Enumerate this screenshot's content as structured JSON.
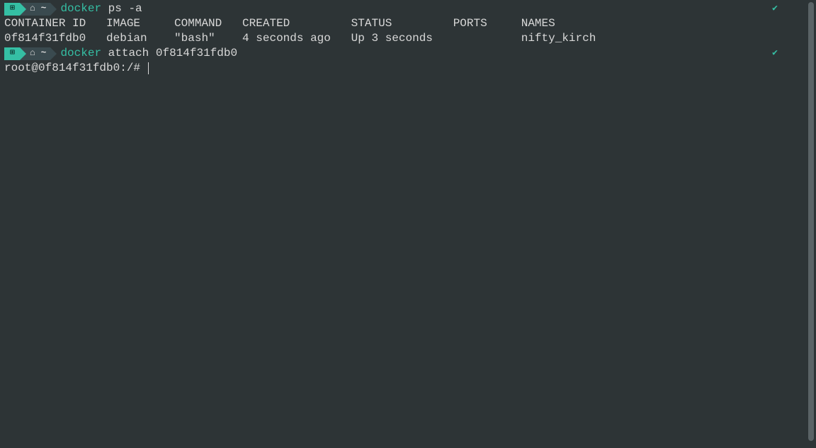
{
  "prompt1": {
    "path_icon": "⌂",
    "path_tilde": "~",
    "cmd_name": "docker",
    "cmd_args": " ps -a",
    "status": "✔"
  },
  "ps_header": "CONTAINER ID   IMAGE     COMMAND   CREATED         STATUS         PORTS     NAMES",
  "ps_row": "0f814f31fdb0   debian    \"bash\"    4 seconds ago   Up 3 seconds             nifty_kirch",
  "prompt2": {
    "path_icon": "⌂",
    "path_tilde": "~",
    "cmd_name": "docker",
    "cmd_args": " attach 0f814f31fdb0",
    "status": "✔"
  },
  "shell_prompt": "root@0f814f31fdb0:/# "
}
